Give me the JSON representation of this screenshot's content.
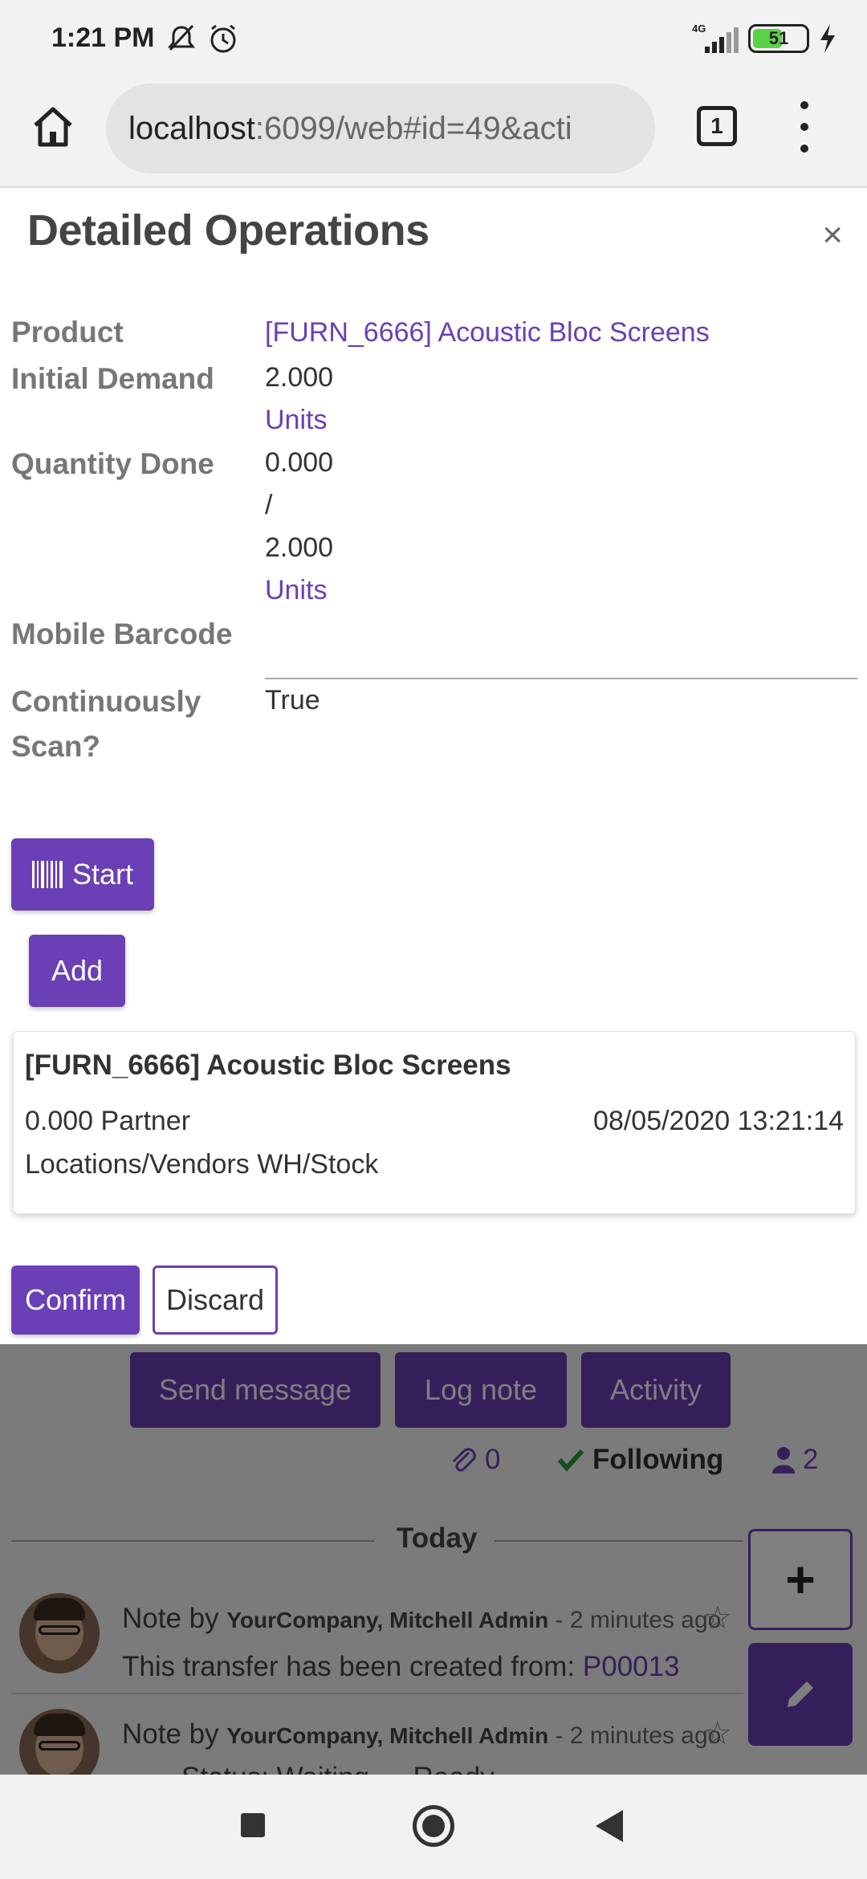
{
  "status_bar": {
    "time": "1:21 PM",
    "network": "4G",
    "battery": "51",
    "icons": [
      "mute-icon",
      "alarm-icon",
      "signal-icon",
      "battery-icon",
      "charging-icon"
    ]
  },
  "browser": {
    "url_host": "localhost",
    "url_path": ":6099/web#id=49&acti",
    "tab_count": "1"
  },
  "dialog": {
    "title": "Detailed Operations",
    "close_label": "×",
    "fields": {
      "product_label": "Product",
      "product_value": "[FURN_6666] Acoustic Bloc Screens",
      "initial_demand_label": "Initial Demand",
      "initial_demand_value": "2.000",
      "initial_demand_uom": "Units",
      "quantity_done_label": "Quantity Done",
      "quantity_done_value": "0.000",
      "quantity_done_sep": "/",
      "quantity_done_total": "2.000",
      "quantity_done_uom": "Units",
      "mobile_barcode_label": "Mobile Barcode",
      "continuously_scan_label_1": "Continuously",
      "continuously_scan_label_2": "Scan?",
      "continuously_scan_value": "True"
    },
    "start_label": "Start",
    "add_label": "Add",
    "line": {
      "title": "[FURN_6666] Acoustic Bloc Screens",
      "qty_from": "0.000 Partner",
      "date": "08/05/2020 13:21:14",
      "locations": "Locations/Vendors WH/Stock"
    },
    "confirm_label": "Confirm",
    "discard_label": "Discard"
  },
  "chatter": {
    "send_message": "Send message",
    "log_note": "Log note",
    "activity": "Activity",
    "attachments": "0",
    "following": "Following",
    "followers": "2",
    "today": "Today",
    "notes": [
      {
        "prefix": "Note by",
        "author": "YourCompany, Mitchell Admin",
        "sep": " - ",
        "ago": "2 minutes ago",
        "body_text": "This transfer has been created from: ",
        "body_link": "P00013"
      },
      {
        "prefix": "Note by",
        "author": "YourCompany, Mitchell Admin",
        "sep": " - ",
        "ago": "2 minutes ago",
        "body_text": "Status: Waiting → Ready"
      }
    ],
    "fab_plus": "+"
  },
  "colors": {
    "accent": "#6b3fb5",
    "label_gray": "#777777",
    "backdrop_dim": "rgba(0,0,0,0.5)"
  }
}
